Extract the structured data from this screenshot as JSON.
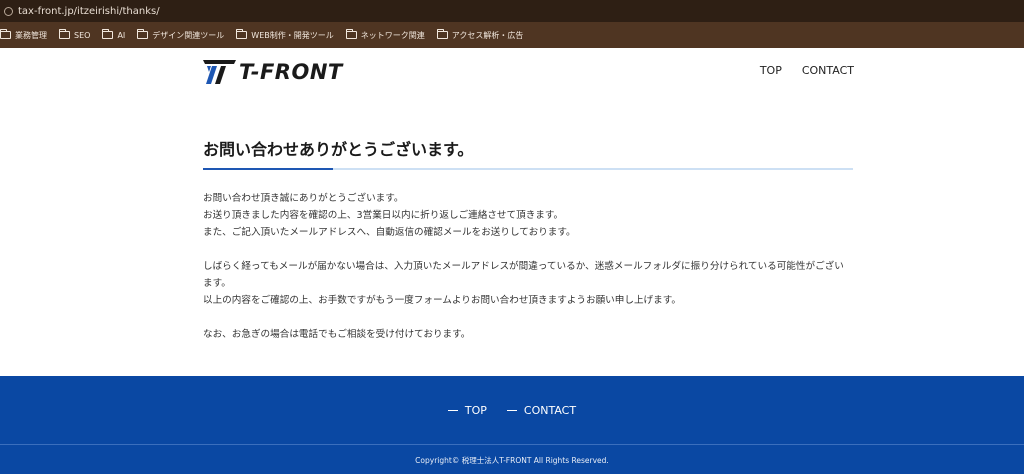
{
  "browser": {
    "url": "tax-front.jp/itzeirishi/thanks/",
    "bookmarks": [
      {
        "label": "業務管理"
      },
      {
        "label": "SEO"
      },
      {
        "label": "AI"
      },
      {
        "label": "デザイン関連ツール"
      },
      {
        "label": "WEB制作・開発ツール"
      },
      {
        "label": "ネットワーク関連"
      },
      {
        "label": "アクセス解析・広告"
      }
    ]
  },
  "header": {
    "logo_text": "T-FRONT",
    "nav": [
      {
        "label": "TOP"
      },
      {
        "label": "CONTACT"
      }
    ]
  },
  "colors": {
    "accent": "#1e57b3",
    "footer": "#0a48a3",
    "chrome_dark": "#2e1f14",
    "bookmarks_bar": "#4f3522"
  },
  "main": {
    "heading": "お問い合わせありがとうございます。",
    "paragraphs": [
      [
        "お問い合わせ頂き誠にありがとうございます。",
        "お送り頂きました内容を確認の上、3営業日以内に折り返しご連絡させて頂きます。",
        "また、ご記入頂いたメールアドレスへ、自動返信の確認メールをお送りしております。"
      ],
      [
        "しばらく経ってもメールが届かない場合は、入力頂いたメールアドレスが間違っているか、迷惑メールフォルダに振り分けられている可能性がございます。",
        "以上の内容をご確認の上、お手数ですがもう一度フォームよりお問い合わせ頂きますようお願い申し上げます。"
      ],
      [
        "なお、お急ぎの場合は電話でもご相談を受け付けております。"
      ]
    ]
  },
  "footer": {
    "nav": [
      {
        "label": "TOP"
      },
      {
        "label": "CONTACT"
      }
    ],
    "copyright": "Copyright© 税理士法人T-FRONT All Rights Reserved."
  }
}
